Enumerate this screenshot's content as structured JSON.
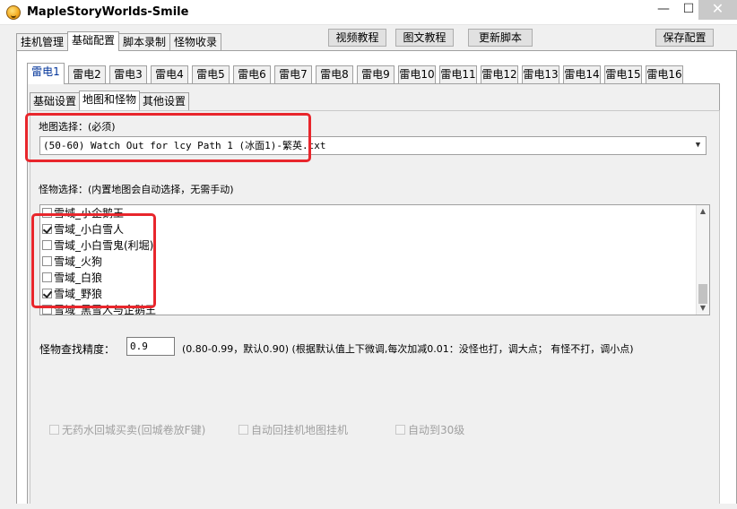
{
  "window": {
    "title": "MapleStoryWorlds-Smile",
    "min_glyph": "—",
    "max_glyph": "☐",
    "close_glyph": "✕"
  },
  "main_tabs": [
    "挂机管理",
    "基础配置",
    "脚本录制",
    "怪物收录"
  ],
  "top_buttons": {
    "video_tutorial": "视频教程",
    "text_tutorial": "图文教程",
    "update_script": "更新脚本",
    "save_config": "保存配置"
  },
  "sub_tabs": [
    "雷电1",
    "雷电2",
    "雷电3",
    "雷电4",
    "雷电5",
    "雷电6",
    "雷电7",
    "雷电8",
    "雷电9",
    "雷电10",
    "雷电11",
    "雷电12",
    "雷电13",
    "雷电14",
    "雷电15",
    "雷电16"
  ],
  "inner_tabs": [
    "基础设置",
    "地图和怪物",
    "其他设置"
  ],
  "map": {
    "label": "地图选择：(必须)",
    "selected": "(50-60) Watch Out for lcy Path 1 (冰面1)-繁英.txt"
  },
  "monsters": {
    "label": "怪物选择：(内置地图会自动选择，无需手动)",
    "items": [
      {
        "label": "雪域_小企鹅王",
        "checked": false
      },
      {
        "label": "雪域_小白雪人",
        "checked": true
      },
      {
        "label": "雪域_小白雪鬼(利堀)",
        "checked": false
      },
      {
        "label": "雪域_火狗",
        "checked": false
      },
      {
        "label": "雪域_白狼",
        "checked": false
      },
      {
        "label": "雪域_野狼",
        "checked": true
      },
      {
        "label": "雪域_黑雪人与企鹅王",
        "checked": false
      }
    ]
  },
  "precision": {
    "label": "怪物查找精度：",
    "value": "0.9",
    "hint": "(0.80-0.99，默认0.90)  (根据默认值上下微调,每次加减0.01：没怪也打，调大点； 有怪不打，调小点)"
  },
  "options": [
    {
      "label": "无药水回城买卖(回城卷放F键)",
      "checked": false
    },
    {
      "label": "自动回挂机地图挂机",
      "checked": false
    },
    {
      "label": "自动到30级",
      "checked": false
    }
  ],
  "colors": {
    "highlight_box": "#e8262c",
    "active_tab_text": "#003399"
  }
}
